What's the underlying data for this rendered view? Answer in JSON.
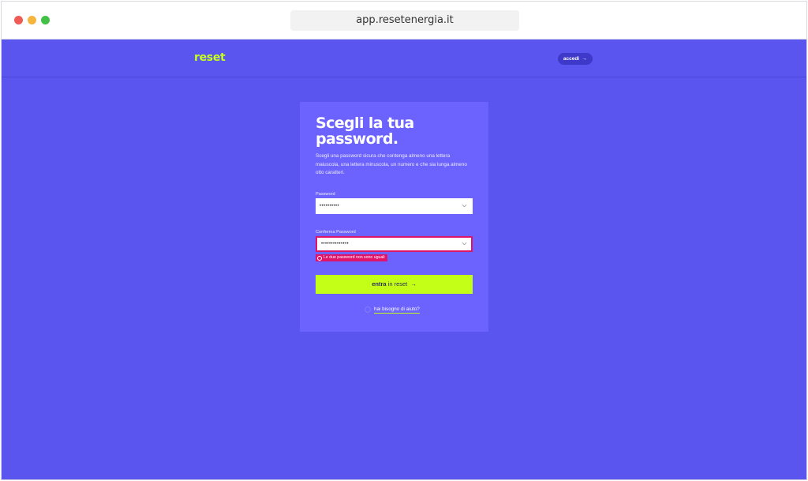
{
  "browser": {
    "url": "app.resetenergia.it"
  },
  "header": {
    "logo": "reset",
    "login_label": "accedi",
    "login_arrow": "→"
  },
  "form": {
    "title": "Scegli la tua password.",
    "description": "Scegli una password sicura che contenga almeno una lettera maiuscola, una lettera minuscola, un numero e che sia lunga almeno otto caratteri.",
    "password_label": "Password",
    "password_value": "••••••••••",
    "confirm_label": "Conferma Password",
    "confirm_value": "••••••••••••••",
    "error_text": "Le due password non sono uguali",
    "submit_bold": "entra",
    "submit_rest": " in reset",
    "submit_arrow": "→",
    "help_link": "hai bisogno di aiuto?"
  },
  "colors": {
    "background": "#5b55f0",
    "card": "#6c63ff",
    "accent": "#c3ff17",
    "error": "#e0136b"
  }
}
